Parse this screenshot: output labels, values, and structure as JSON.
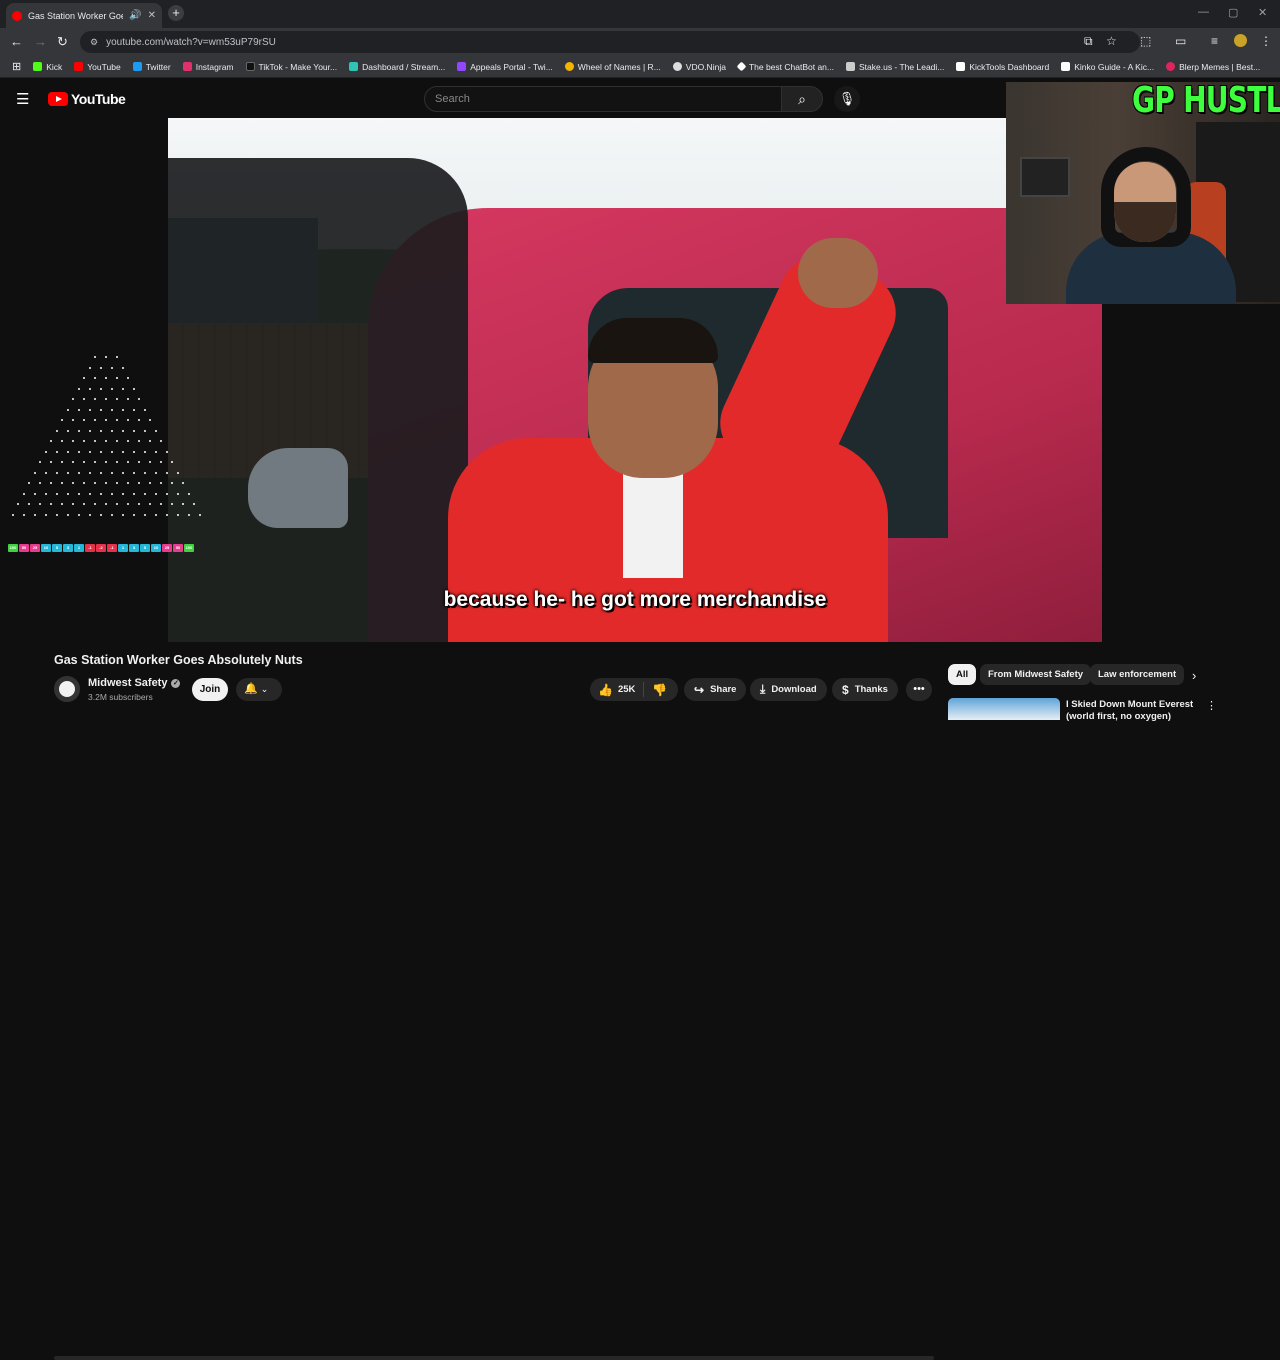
{
  "browser": {
    "tab_title": "Gas Station Worker Goes Ab",
    "new_tab": "+",
    "url": "youtube.com/watch?v=wm53uP79rSU",
    "window_controls": [
      "—",
      "▢",
      "✕"
    ],
    "bookmarks": [
      {
        "label": "Kick",
        "color": "#53fc18"
      },
      {
        "label": "YouTube",
        "color": "#ff0000"
      },
      {
        "label": "Twitter",
        "color": "#1d9bf0"
      },
      {
        "label": "Instagram",
        "color": "#e1306c"
      },
      {
        "label": "TikTok - Make Your...",
        "color": "#111111"
      },
      {
        "label": "Dashboard / Stream...",
        "color": "#2ec4b6"
      },
      {
        "label": "Appeals Portal - Twi...",
        "color": "#9146ff"
      },
      {
        "label": "Wheel of Names | R...",
        "color": "#f4b400"
      },
      {
        "label": "VDO.Ninja",
        "color": "#dddddd"
      },
      {
        "label": "The best ChatBot an...",
        "color": "#ffffff"
      },
      {
        "label": "Stake.us - The Leadi...",
        "color": "#cccccc"
      },
      {
        "label": "KickTools Dashboard",
        "color": "#ffffff"
      },
      {
        "label": "Kinko Guide - A Kic...",
        "color": "#ffffff"
      },
      {
        "label": "Blerp Memes | Best...",
        "color": "#e0245e"
      }
    ]
  },
  "youtube": {
    "logo_text": "YouTube",
    "search_placeholder": "Search",
    "subtitle": "because he- he got more merchandise",
    "video_title": "Gas Station Worker Goes Absolutely Nuts",
    "channel_name": "Midwest Safety",
    "subscribers": "3.2M subscribers",
    "join_label": "Join",
    "likes": "25K",
    "share_label": "Share",
    "download_label": "Download",
    "thanks_label": "Thanks",
    "chips": [
      "All",
      "From Midwest Safety",
      "Law enforcement"
    ],
    "rec_title": "I Skied Down Mount Everest (world first, no oxygen)"
  },
  "overlay": {
    "webcam_title": "GP HUSTLA",
    "plinko_values": [
      "100",
      "50",
      "25",
      "10",
      "5",
      "3",
      "1",
      "-1",
      "-2",
      "-1",
      "1",
      "3",
      "5",
      "10",
      "25",
      "50",
      "100"
    ],
    "plinko_colors": [
      "#3fd43f",
      "#e83b8d",
      "#e83b8d",
      "#23b8d8",
      "#23b8d8",
      "#23b8d8",
      "#23b8d8",
      "#e8304a",
      "#e8304a",
      "#e8304a",
      "#23b8d8",
      "#23b8d8",
      "#23b8d8",
      "#23b8d8",
      "#e83b8d",
      "#e83b8d",
      "#3fd43f"
    ]
  }
}
